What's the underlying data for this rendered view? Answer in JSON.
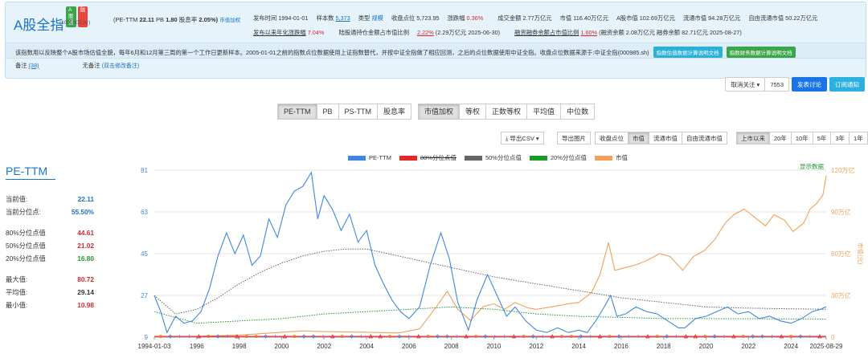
{
  "header": {
    "badges": [
      "A股通",
      "融"
    ],
    "title": "A股全指",
    "code": "(1000002.lxr)",
    "pe_ttm": "(PE-TTM",
    "pe_ttm_value": "22.11",
    "pb": "PB",
    "pb_value": "1.80",
    "dividend": "股息率",
    "dividend_value": "2.05%)",
    "market_cap_link": "市值加权",
    "row1": {
      "publish": "发布时间 1994-01-01",
      "sample_label": "样本数",
      "sample_value": "5,373",
      "type_label": "类型",
      "type_value": "规模",
      "close": "收盘点位 5,723.95",
      "change_label": "涨跌幅",
      "change_value": "0.36%",
      "turnover": "成交金额 2.77万亿元",
      "mcap": "市值 116.40万亿元",
      "amcap": "A股市值 102.69万亿元",
      "float_mcap": "流通市值 94.28万亿元",
      "free_float": "自由流通市值 50.22万亿元"
    },
    "row2": {
      "change_since_label": "发布以来年化涨跌幅",
      "change_since_value": "7.04%",
      "connect_label": "陆股通持仓金额占市值比例",
      "connect_value": "2.22%",
      "connect_extra": "(2.29万亿元 2025-06-30)",
      "margin_label": "融资融券余额占市值比例",
      "margin_value": "1.60%",
      "margin_extra": "(融资余额 2.08万亿元 融券余额 82.71亿元 2025-08-27)"
    },
    "description": "该指数用以反映整个A股市场估值全貌，每年6月和12月第三周的第一个工作日更新样本。2005-01-01之前的指数点位数据使用上证指数替代，并按中证全指做了相应回测，之后的点位数据使用中证全指。收盘点位数据来源于:中证全指(000985.sh)",
    "pill1": "指数估值数据计算说明文档",
    "pill2": "指数财务数据计算说明文档",
    "note_label": "备注",
    "note_count": "(38)",
    "no_note": "无备注",
    "no_note_link": "(双击修改备注)"
  },
  "follow": {
    "cancel": "取消关注",
    "count": "7553",
    "discuss": "发表讨论",
    "subscribe": "订阅通知"
  },
  "metrics": [
    "PE-TTM",
    "PB",
    "PS-TTM",
    "股息率"
  ],
  "weighting": [
    "市值加权",
    "等权",
    "正数等权",
    "平均值",
    "中位数"
  ],
  "toolbar": {
    "export_csv": "导出CSV",
    "export_img": "导出图片",
    "series_opts": [
      "收盘点位",
      "市值",
      "流通市值",
      "自由流通市值"
    ],
    "ranges": [
      "上市以来",
      "20年",
      "10年",
      "5年",
      "3年",
      "1年"
    ]
  },
  "stats": {
    "title": "PE-TTM",
    "current_label": "当前值:",
    "current_value": "22.11",
    "pct_label": "当前分位点:",
    "pct_value": "55.50%",
    "p80_label": "80%分位点值",
    "p80_value": "44.61",
    "p50_label": "50%分位点值",
    "p50_value": "21.02",
    "p20_label": "20%分位点值",
    "p20_value": "16.80",
    "max_label": "最大值:",
    "max_value": "80.72",
    "avg_label": "平均值:",
    "avg_value": "29.14",
    "min_label": "最小值:",
    "min_value": "10.98"
  },
  "colors": {
    "blue": "#3f86e2",
    "red": "#e8262a",
    "gray": "#666666",
    "green": "#1a9a2a",
    "orange": "#f2a15a",
    "accent": "#1a73c8"
  },
  "chart_data": {
    "type": "line",
    "legend": [
      "PE-TTM",
      "80%分位点值",
      "50%分位点值",
      "20%分位点值",
      "市值"
    ],
    "show_data_link": "显示数据",
    "left_axis": {
      "ticks": [
        "81",
        "63",
        "45",
        "27",
        "9"
      ],
      "range": [
        9,
        81
      ]
    },
    "right_axis": {
      "label": "市值(元)",
      "ticks": [
        "120万亿",
        "90万亿",
        "60万亿",
        "30万亿",
        "0"
      ],
      "range": [
        0,
        120
      ]
    },
    "x_ticks": [
      "1994-01-03",
      "1996",
      "1998",
      "2000",
      "2002",
      "2004",
      "2006",
      "2008",
      "2010",
      "2012",
      "2014",
      "2016",
      "2018",
      "2020",
      "2022",
      "2024",
      "2025-08-29"
    ],
    "x_range": [
      1994.0,
      2025.66
    ],
    "series": [
      {
        "name": "PE-TTM",
        "axis": "left",
        "color": "#3f86e2",
        "points": [
          [
            1994.0,
            27
          ],
          [
            1994.3,
            20
          ],
          [
            1994.6,
            11
          ],
          [
            1995.0,
            18
          ],
          [
            1995.4,
            15
          ],
          [
            1995.8,
            16
          ],
          [
            1996.2,
            20
          ],
          [
            1996.6,
            30
          ],
          [
            1997.0,
            44
          ],
          [
            1997.4,
            54
          ],
          [
            1997.8,
            45
          ],
          [
            1998.2,
            53
          ],
          [
            1998.6,
            40
          ],
          [
            1999.0,
            44
          ],
          [
            1999.4,
            60
          ],
          [
            1999.8,
            52
          ],
          [
            2000.2,
            66
          ],
          [
            2000.6,
            72
          ],
          [
            2001.0,
            74
          ],
          [
            2001.4,
            80
          ],
          [
            2001.7,
            60
          ],
          [
            2002.0,
            70
          ],
          [
            2002.4,
            64
          ],
          [
            2002.8,
            55
          ],
          [
            2003.2,
            62
          ],
          [
            2003.6,
            50
          ],
          [
            2004.0,
            55
          ],
          [
            2004.4,
            40
          ],
          [
            2004.8,
            32
          ],
          [
            2005.2,
            25
          ],
          [
            2005.6,
            20
          ],
          [
            2006.0,
            17
          ],
          [
            2006.5,
            22
          ],
          [
            2007.0,
            40
          ],
          [
            2007.5,
            54
          ],
          [
            2007.9,
            43
          ],
          [
            2008.3,
            24
          ],
          [
            2008.8,
            12
          ],
          [
            2009.2,
            25
          ],
          [
            2009.7,
            36
          ],
          [
            2010.1,
            28
          ],
          [
            2010.6,
            18
          ],
          [
            2011.0,
            22
          ],
          [
            2011.5,
            16
          ],
          [
            2012.0,
            12
          ],
          [
            2012.5,
            11
          ],
          [
            2013.0,
            13
          ],
          [
            2013.5,
            11
          ],
          [
            2014.0,
            12
          ],
          [
            2014.4,
            11
          ],
          [
            2014.8,
            16
          ],
          [
            2015.2,
            22
          ],
          [
            2015.5,
            27
          ],
          [
            2015.8,
            18
          ],
          [
            2016.2,
            19
          ],
          [
            2016.7,
            22
          ],
          [
            2017.2,
            20
          ],
          [
            2017.7,
            19
          ],
          [
            2018.2,
            16
          ],
          [
            2018.7,
            13
          ],
          [
            2019.0,
            13
          ],
          [
            2019.5,
            17
          ],
          [
            2020.0,
            18
          ],
          [
            2020.5,
            20
          ],
          [
            2021.0,
            22
          ],
          [
            2021.5,
            19
          ],
          [
            2022.0,
            20
          ],
          [
            2022.5,
            17
          ],
          [
            2023.0,
            18
          ],
          [
            2023.5,
            16
          ],
          [
            2024.0,
            15
          ],
          [
            2024.5,
            17
          ],
          [
            2025.0,
            20
          ],
          [
            2025.4,
            21
          ],
          [
            2025.66,
            22.11
          ]
        ]
      },
      {
        "name": "50%分位点值",
        "axis": "left",
        "color": "#666666",
        "dashed": true,
        "points": [
          [
            1994.0,
            27
          ],
          [
            1995.0,
            19
          ],
          [
            1996.0,
            21
          ],
          [
            1997.0,
            26
          ],
          [
            1998.0,
            32
          ],
          [
            1999.0,
            37
          ],
          [
            2000.0,
            41
          ],
          [
            2001.0,
            44
          ],
          [
            2002.0,
            46
          ],
          [
            2003.0,
            47
          ],
          [
            2004.0,
            47
          ],
          [
            2005.0,
            45
          ],
          [
            2006.0,
            43
          ],
          [
            2007.0,
            41
          ],
          [
            2008.0,
            39
          ],
          [
            2010.0,
            35
          ],
          [
            2012.0,
            32
          ],
          [
            2014.0,
            29
          ],
          [
            2016.0,
            26
          ],
          [
            2018.0,
            24
          ],
          [
            2020.0,
            22
          ],
          [
            2022.0,
            21.5
          ],
          [
            2025.66,
            21.02
          ]
        ]
      },
      {
        "name": "20%分位点值",
        "axis": "left",
        "color": "#1a9a2a",
        "dashed": true,
        "points": [
          [
            1994.0,
            20
          ],
          [
            1996.0,
            15
          ],
          [
            1998.0,
            16
          ],
          [
            2000.0,
            17
          ],
          [
            2002.0,
            19
          ],
          [
            2004.0,
            20
          ],
          [
            2006.0,
            21
          ],
          [
            2008.0,
            22
          ],
          [
            2010.0,
            21
          ],
          [
            2012.0,
            19
          ],
          [
            2014.0,
            18
          ],
          [
            2016.0,
            17.5
          ],
          [
            2018.0,
            17
          ],
          [
            2020.0,
            17
          ],
          [
            2025.66,
            16.8
          ]
        ]
      },
      {
        "name": "80%分位点值",
        "axis": "left",
        "color": "#e8262a",
        "points": [
          [
            1994.0,
            9.3
          ],
          [
            2025.66,
            9.3
          ]
        ]
      },
      {
        "name": "市值",
        "axis": "right",
        "color": "#f2a15a",
        "points": [
          [
            1994.0,
            0.3
          ],
          [
            1996.0,
            0.6
          ],
          [
            1998.0,
            1.5
          ],
          [
            2000.0,
            3.5
          ],
          [
            2001.0,
            4.5
          ],
          [
            2002.0,
            4
          ],
          [
            2004.0,
            3.5
          ],
          [
            2005.5,
            3
          ],
          [
            2006.5,
            6
          ],
          [
            2007.3,
            22
          ],
          [
            2007.8,
            33
          ],
          [
            2008.3,
            20
          ],
          [
            2008.9,
            12
          ],
          [
            2009.5,
            22
          ],
          [
            2010.0,
            24
          ],
          [
            2010.5,
            20
          ],
          [
            2011.0,
            25
          ],
          [
            2011.6,
            21
          ],
          [
            2012.0,
            20
          ],
          [
            2012.8,
            22
          ],
          [
            2013.5,
            24
          ],
          [
            2014.0,
            25
          ],
          [
            2014.6,
            32
          ],
          [
            2015.0,
            45
          ],
          [
            2015.4,
            68
          ],
          [
            2015.7,
            48
          ],
          [
            2016.2,
            50
          ],
          [
            2016.7,
            52
          ],
          [
            2017.2,
            55
          ],
          [
            2017.8,
            60
          ],
          [
            2018.3,
            58
          ],
          [
            2018.9,
            48
          ],
          [
            2019.4,
            58
          ],
          [
            2019.9,
            62
          ],
          [
            2020.4,
            70
          ],
          [
            2020.9,
            82
          ],
          [
            2021.3,
            88
          ],
          [
            2021.8,
            92
          ],
          [
            2022.3,
            86
          ],
          [
            2022.8,
            80
          ],
          [
            2023.2,
            88
          ],
          [
            2023.7,
            84
          ],
          [
            2024.1,
            76
          ],
          [
            2024.6,
            82
          ],
          [
            2024.9,
            92
          ],
          [
            2025.2,
            96
          ],
          [
            2025.5,
            102
          ],
          [
            2025.66,
            116
          ]
        ]
      }
    ]
  }
}
